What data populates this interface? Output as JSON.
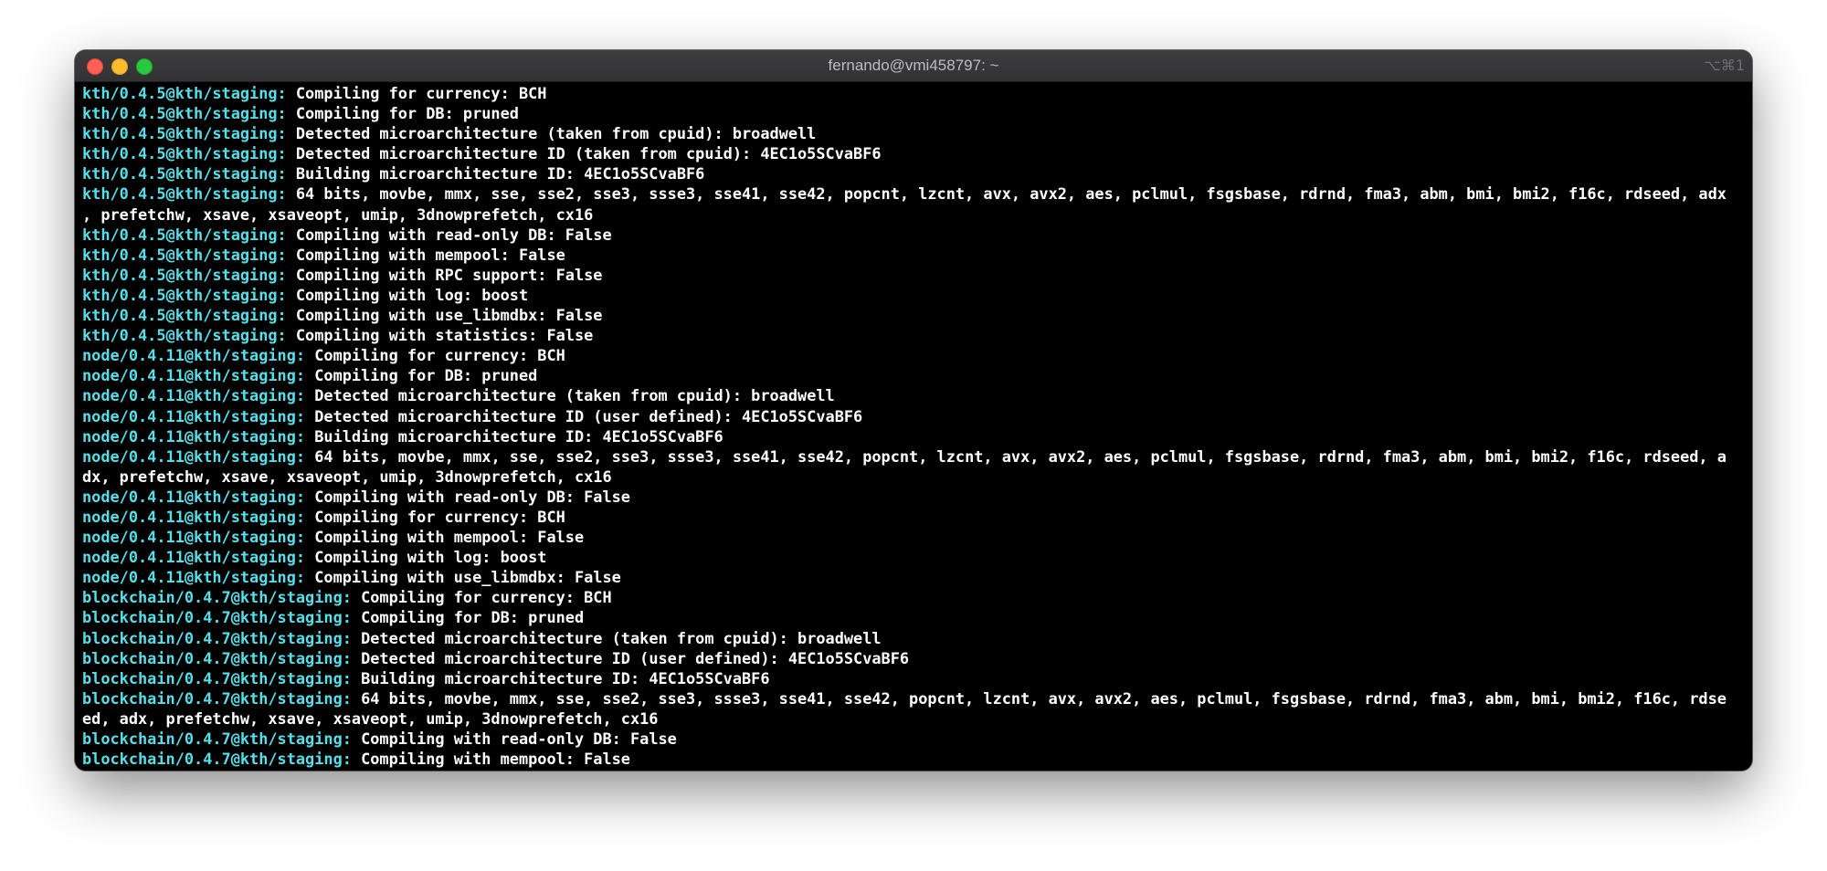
{
  "window": {
    "title": "fernando@vmi458797: ~",
    "shortcut": "⌥⌘1"
  },
  "colors": {
    "prompt": "#56dfe9",
    "text": "#ffffff",
    "background": "#000000",
    "close": "#ff5f57",
    "minimize": "#febc2e",
    "zoom": "#28c840"
  },
  "terminal": {
    "lines": [
      {
        "prefix": "kth/0.4.5@kth/staging:",
        "text": " Compiling for currency: BCH"
      },
      {
        "prefix": "kth/0.4.5@kth/staging:",
        "text": " Compiling for DB: pruned"
      },
      {
        "prefix": "kth/0.4.5@kth/staging:",
        "text": " Detected microarchitecture (taken from cpuid): broadwell"
      },
      {
        "prefix": "kth/0.4.5@kth/staging:",
        "text": " Detected microarchitecture ID (taken from cpuid): 4EC1o5SCvaBF6"
      },
      {
        "prefix": "kth/0.4.5@kth/staging:",
        "text": " Building microarchitecture ID: 4EC1o5SCvaBF6"
      },
      {
        "prefix": "kth/0.4.5@kth/staging:",
        "text": " 64 bits, movbe, mmx, sse, sse2, sse3, ssse3, sse41, sse42, popcnt, lzcnt, avx, avx2, aes, pclmul, fsgsbase, rdrnd, fma3, abm, bmi, bmi2, f16c, rdseed, adx"
      },
      {
        "prefix": "",
        "text": ", prefetchw, xsave, xsaveopt, umip, 3dnowprefetch, cx16"
      },
      {
        "prefix": "kth/0.4.5@kth/staging:",
        "text": " Compiling with read-only DB: False"
      },
      {
        "prefix": "kth/0.4.5@kth/staging:",
        "text": " Compiling with mempool: False"
      },
      {
        "prefix": "kth/0.4.5@kth/staging:",
        "text": " Compiling with RPC support: False"
      },
      {
        "prefix": "kth/0.4.5@kth/staging:",
        "text": " Compiling with log: boost"
      },
      {
        "prefix": "kth/0.4.5@kth/staging:",
        "text": " Compiling with use_libmdbx: False"
      },
      {
        "prefix": "kth/0.4.5@kth/staging:",
        "text": " Compiling with statistics: False"
      },
      {
        "prefix": "node/0.4.11@kth/staging:",
        "text": " Compiling for currency: BCH"
      },
      {
        "prefix": "node/0.4.11@kth/staging:",
        "text": " Compiling for DB: pruned"
      },
      {
        "prefix": "node/0.4.11@kth/staging:",
        "text": " Detected microarchitecture (taken from cpuid): broadwell"
      },
      {
        "prefix": "node/0.4.11@kth/staging:",
        "text": " Detected microarchitecture ID (user defined): 4EC1o5SCvaBF6"
      },
      {
        "prefix": "node/0.4.11@kth/staging:",
        "text": " Building microarchitecture ID: 4EC1o5SCvaBF6"
      },
      {
        "prefix": "node/0.4.11@kth/staging:",
        "text": " 64 bits, movbe, mmx, sse, sse2, sse3, ssse3, sse41, sse42, popcnt, lzcnt, avx, avx2, aes, pclmul, fsgsbase, rdrnd, fma3, abm, bmi, bmi2, f16c, rdseed, a"
      },
      {
        "prefix": "",
        "text": "dx, prefetchw, xsave, xsaveopt, umip, 3dnowprefetch, cx16"
      },
      {
        "prefix": "node/0.4.11@kth/staging:",
        "text": " Compiling with read-only DB: False"
      },
      {
        "prefix": "node/0.4.11@kth/staging:",
        "text": " Compiling for currency: BCH"
      },
      {
        "prefix": "node/0.4.11@kth/staging:",
        "text": " Compiling with mempool: False"
      },
      {
        "prefix": "node/0.4.11@kth/staging:",
        "text": " Compiling with log: boost"
      },
      {
        "prefix": "node/0.4.11@kth/staging:",
        "text": " Compiling with use_libmdbx: False"
      },
      {
        "prefix": "blockchain/0.4.7@kth/staging:",
        "text": " Compiling for currency: BCH"
      },
      {
        "prefix": "blockchain/0.4.7@kth/staging:",
        "text": " Compiling for DB: pruned"
      },
      {
        "prefix": "blockchain/0.4.7@kth/staging:",
        "text": " Detected microarchitecture (taken from cpuid): broadwell"
      },
      {
        "prefix": "blockchain/0.4.7@kth/staging:",
        "text": " Detected microarchitecture ID (user defined): 4EC1o5SCvaBF6"
      },
      {
        "prefix": "blockchain/0.4.7@kth/staging:",
        "text": " Building microarchitecture ID: 4EC1o5SCvaBF6"
      },
      {
        "prefix": "blockchain/0.4.7@kth/staging:",
        "text": " 64 bits, movbe, mmx, sse, sse2, sse3, ssse3, sse41, sse42, popcnt, lzcnt, avx, avx2, aes, pclmul, fsgsbase, rdrnd, fma3, abm, bmi, bmi2, f16c, rdse"
      },
      {
        "prefix": "",
        "text": "ed, adx, prefetchw, xsave, xsaveopt, umip, 3dnowprefetch, cx16"
      },
      {
        "prefix": "blockchain/0.4.7@kth/staging:",
        "text": " Compiling with read-only DB: False"
      },
      {
        "prefix": "blockchain/0.4.7@kth/staging:",
        "text": " Compiling with mempool: False"
      }
    ]
  }
}
